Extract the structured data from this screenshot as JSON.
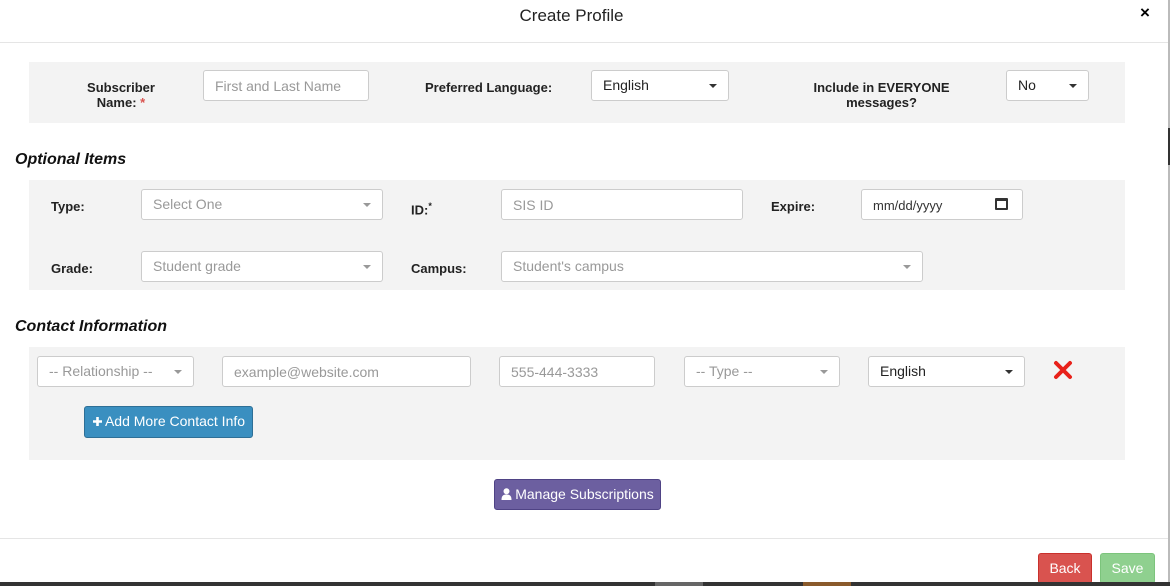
{
  "modal": {
    "title": "Create Profile",
    "close_label": "×"
  },
  "profile": {
    "subscriber_label": "Subscriber Name:",
    "subscriber_label_line1": "Subscriber",
    "subscriber_label_line2": "Name:",
    "required_mark": "*",
    "name_placeholder": "First and Last Name",
    "preferred_language_label": "Preferred Language:",
    "preferred_language_value": "English",
    "everyone_label_line1": "Include in EVERYONE",
    "everyone_label_line2": "messages?",
    "everyone_value": "No"
  },
  "optional": {
    "section_title": "Optional Items",
    "type_label": "Type:",
    "type_placeholder": "Select One",
    "id_label": "ID:",
    "id_required_mark": "*",
    "id_placeholder": "SIS ID",
    "expire_label": "Expire:",
    "expire_placeholder": "mm/dd/yyyy",
    "grade_label": "Grade:",
    "grade_placeholder": "Student grade",
    "campus_label": "Campus:",
    "campus_placeholder": "Student's campus"
  },
  "contact": {
    "section_title": "Contact Information",
    "relationship_placeholder": "-- Relationship --",
    "email_placeholder": "example@website.com",
    "phone_placeholder": "555-444-3333",
    "type_placeholder": "-- Type --",
    "language_value": "English",
    "add_more_label": "Add More Contact Info",
    "add_more_icon": "plus-icon"
  },
  "actions": {
    "manage_subscriptions_label": "Manage Subscriptions",
    "manage_icon": "user-icon",
    "back_label": "Back",
    "save_label": "Save"
  },
  "colors": {
    "add_button": "#3a8fc0",
    "manage_button": "#6c5fa0",
    "back_button": "#d9534f",
    "save_button": "#8fd08f",
    "delete_icon": "#e8211a"
  }
}
